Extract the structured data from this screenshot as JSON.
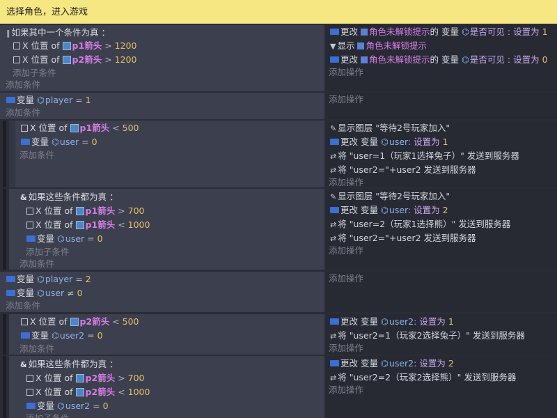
{
  "comment": "选择角色，进入游戏",
  "common": {
    "add_subcondition": "添加子条件",
    "add_condition": "添加条件",
    "add_action": "添加操作",
    "x_position_of": "X 位置 of",
    "variable": "变量",
    "change": "更改",
    "change_variable": "更改 变量",
    "show": "显示",
    "show_layer": "显示图层",
    "send_prefix": "将",
    "send_suffix": "发送到服务器",
    "set_to": "设置为",
    "of_variable": "的 变量",
    "is_visible": "是否可见"
  },
  "events": [
    {
      "or_header": "如果其中一个条件为真 ：",
      "conditions": [
        {
          "object": "p1箭头",
          "op": ">",
          "value": "1200"
        },
        {
          "object": "p2箭头",
          "op": ">",
          "value": "1200"
        }
      ],
      "actions": [
        {
          "object": "角色未解锁提示",
          "var": "是否可见",
          "value": "1"
        },
        {
          "object": "角色未解锁提示"
        },
        {
          "object": "角色未解锁提示",
          "var": "是否可见",
          "value": "0"
        }
      ]
    },
    {
      "cond_var": "player",
      "cond_op": "=",
      "cond_val": "1",
      "sub1": {
        "cond_object": "p1箭头",
        "cond_op": "<",
        "cond_val": "500",
        "var_name": "user",
        "var_op": "=",
        "var_val": "0",
        "layer": "\"等待2号玩家加入\"",
        "set_var": "user:",
        "set_val": "1",
        "send1": "\"user=1（玩家1选择兔子）\"",
        "send2": "\"user2=\"+user2"
      },
      "sub2": {
        "and_header": "如果这些条件都为真 ：",
        "c1_object": "p1箭头",
        "c1_op": ">",
        "c1_val": "700",
        "c2_object": "p1箭头",
        "c2_op": "<",
        "c2_val": "1000",
        "var_name": "user",
        "var_op": "=",
        "var_val": "0",
        "layer": "\"等待2号玩家加入\"",
        "set_var": "user:",
        "set_val": "2",
        "send1": "\"user=2（玩家1选择熊）\"",
        "send2": "\"user2=\"+user2"
      }
    },
    {
      "c1_var": "player",
      "c1_op": "=",
      "c1_val": "2",
      "c2_var": "user",
      "c2_op": "≠",
      "c2_val": "0",
      "sub1": {
        "cond_object": "p2箭头",
        "cond_op": "<",
        "cond_val": "500",
        "var_name": "user2",
        "var_op": "=",
        "var_val": "0",
        "set_var": "user2:",
        "set_val": "1",
        "send1": "\"user2=1（玩家2选择兔子）\""
      },
      "sub2": {
        "and_header": "如果这些条件都为真 ：",
        "c1_object": "p2箭头",
        "c1_op": ">",
        "c1_val": "700",
        "c2_object": "p2箭头",
        "c2_op": "<",
        "c2_val": "1000",
        "var_name": "user2",
        "var_op": "=",
        "var_val": "0",
        "set_var": "user2:",
        "set_val": "2",
        "send1": "\"user2=2（玩家2选择熊）\""
      }
    }
  ]
}
